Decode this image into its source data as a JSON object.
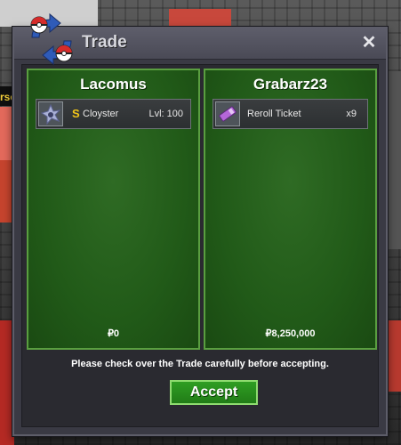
{
  "window": {
    "title": "Trade"
  },
  "left": {
    "name": "Lacomus",
    "item": {
      "badge": "S",
      "name": "Cloyster",
      "level": "Lvl: 100"
    },
    "money": "₽0"
  },
  "right": {
    "name": "Grabarz23",
    "item": {
      "name": "Reroll Ticket",
      "qty": "x9"
    },
    "money": "₽8,250,000"
  },
  "notice": "Please check over the Trade carefully before accepting.",
  "accept_label": "Accept",
  "background": {
    "side_text": "rse"
  },
  "icons": [
    "pokeball-logo-icon",
    "close-icon",
    "cloyster-sprite-icon",
    "reroll-ticket-icon"
  ]
}
